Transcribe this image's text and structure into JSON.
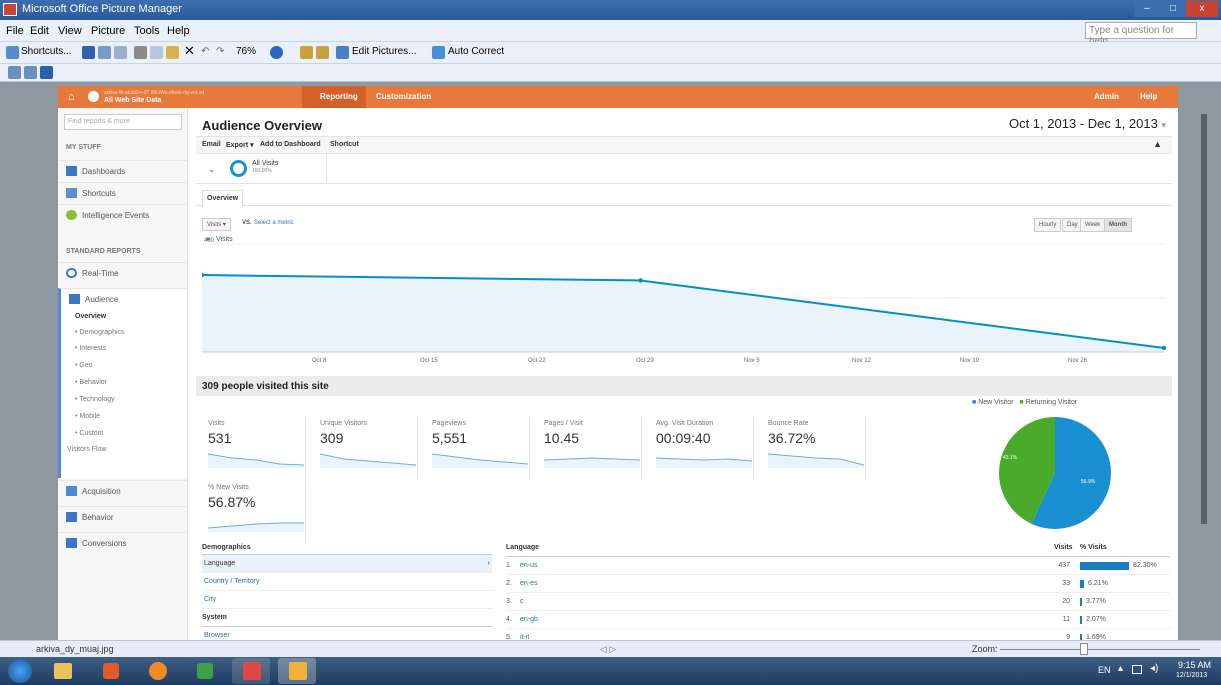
{
  "window": {
    "title": "Microsoft Office Picture Manager",
    "min": "–",
    "max": "□",
    "close": "x"
  },
  "menu": [
    "File",
    "Edit",
    "View",
    "Picture",
    "Tools",
    "Help"
  ],
  "ask_placeholder": "Type a question for help",
  "toolbar": {
    "shortcuts": "Shortcuts...",
    "zoom": "76%",
    "edit_pictures": "Edit Pictures...",
    "auto_correct": "Auto Correct"
  },
  "nav": {
    "site_line1": "arkiva-fb-ab3d9-r-37.90l-iWx-dkwis-dg-vnt-xd",
    "site_line2": "All Web Site Data",
    "tabs": [
      "Reporting",
      "Customization"
    ],
    "right": [
      "Admin",
      "Help"
    ]
  },
  "sidebar": {
    "search_placeholder": "Find reports & more",
    "my_stuff": "MY STUFF",
    "my_items": [
      "Dashboards",
      "Shortcuts",
      "Intelligence Events"
    ],
    "standard": "STANDARD REPORTS",
    "realtime": "Real-Time",
    "audience": "Audience",
    "audience_sub": [
      "Overview",
      "• Demographics",
      "• Interests",
      "• Geo",
      "• Behavior",
      "• Technology",
      "• Mobile",
      "• Custom",
      "Visitors Flow"
    ],
    "bottom": [
      "Acquisition",
      "Behavior",
      "Conversions"
    ]
  },
  "main": {
    "title": "Audience Overview",
    "date_range": "Oct 1, 2013 - Dec 1, 2013",
    "date_caret": "▾",
    "actions": [
      "Email",
      "Export ▾",
      "Add to Dashboard",
      "Shortcut"
    ],
    "segment": {
      "name": "All Visits",
      "pct": "100.00%"
    },
    "tab": "Overview",
    "metric_select": "Visits",
    "vs": "VS.",
    "select_metric": "Select a metric",
    "granularity": [
      "Hourly",
      "Day",
      "Week",
      "Month"
    ],
    "legend_visits": "Visits",
    "y_ticks": [
      "400",
      "200"
    ],
    "visited_title": "309 people visited this site"
  },
  "chart_data": {
    "type": "line",
    "title": "",
    "series": [
      {
        "name": "Visits",
        "x": [
          "Oct 1",
          "Oct 29",
          "Dec 1"
        ],
        "values": [
          285,
          265,
          15
        ]
      }
    ],
    "ylim": [
      0,
      400
    ],
    "x_ticks": [
      "Oct 8",
      "Oct 15",
      "Oct 22",
      "Oct 29",
      "Nov 5",
      "Nov 12",
      "Nov 19",
      "Nov 26"
    ],
    "ylabel": "",
    "xlabel": ""
  },
  "metrics": [
    {
      "label": "Visits",
      "value": "531"
    },
    {
      "label": "Unique Visitors",
      "value": "309"
    },
    {
      "label": "Pageviews",
      "value": "5,551"
    },
    {
      "label": "Pages / Visit",
      "value": "10.45"
    },
    {
      "label": "Avg. Visit Duration",
      "value": "00:09:40"
    },
    {
      "label": "Bounce Rate",
      "value": "36.72%"
    },
    {
      "label": "% New Visits",
      "value": "56.87%"
    }
  ],
  "pie": {
    "legend": [
      "New Visitor",
      "Returning Visitor"
    ],
    "new_pct": 56.9,
    "new_label": "56.9%",
    "ret_label": "43.1%",
    "new_color": "#1a8fd1",
    "ret_color": "#4aab2b"
  },
  "demographics": {
    "title": "Demographics",
    "items": [
      "Language",
      "Country / Territory",
      "City"
    ],
    "system": "System",
    "sys_items": [
      "Browser"
    ]
  },
  "language_table": {
    "title": "Language",
    "col_visits": "Visits",
    "col_pct": "% Visits",
    "rows": [
      {
        "n": "1.",
        "lang": "en-us",
        "visits": "437",
        "pct": "82.30%",
        "frac": 0.823
      },
      {
        "n": "2.",
        "lang": "en-es",
        "visits": "33",
        "pct": "6.21%",
        "frac": 0.0621
      },
      {
        "n": "3.",
        "lang": "c",
        "visits": "20",
        "pct": "3.77%",
        "frac": 0.0377
      },
      {
        "n": "4.",
        "lang": "en-gb",
        "visits": "11",
        "pct": "2.07%",
        "frac": 0.0207
      },
      {
        "n": "5.",
        "lang": "it-it",
        "visits": "9",
        "pct": "1.69%",
        "frac": 0.0169
      }
    ]
  },
  "status": {
    "file": "arkiva_dy_muaj.jpg",
    "nav": "◁ ▷",
    "zoom": "Zoom:"
  },
  "taskbar": {
    "lang": "EN",
    "time": "9:15 AM",
    "date": "12/1/2013"
  }
}
